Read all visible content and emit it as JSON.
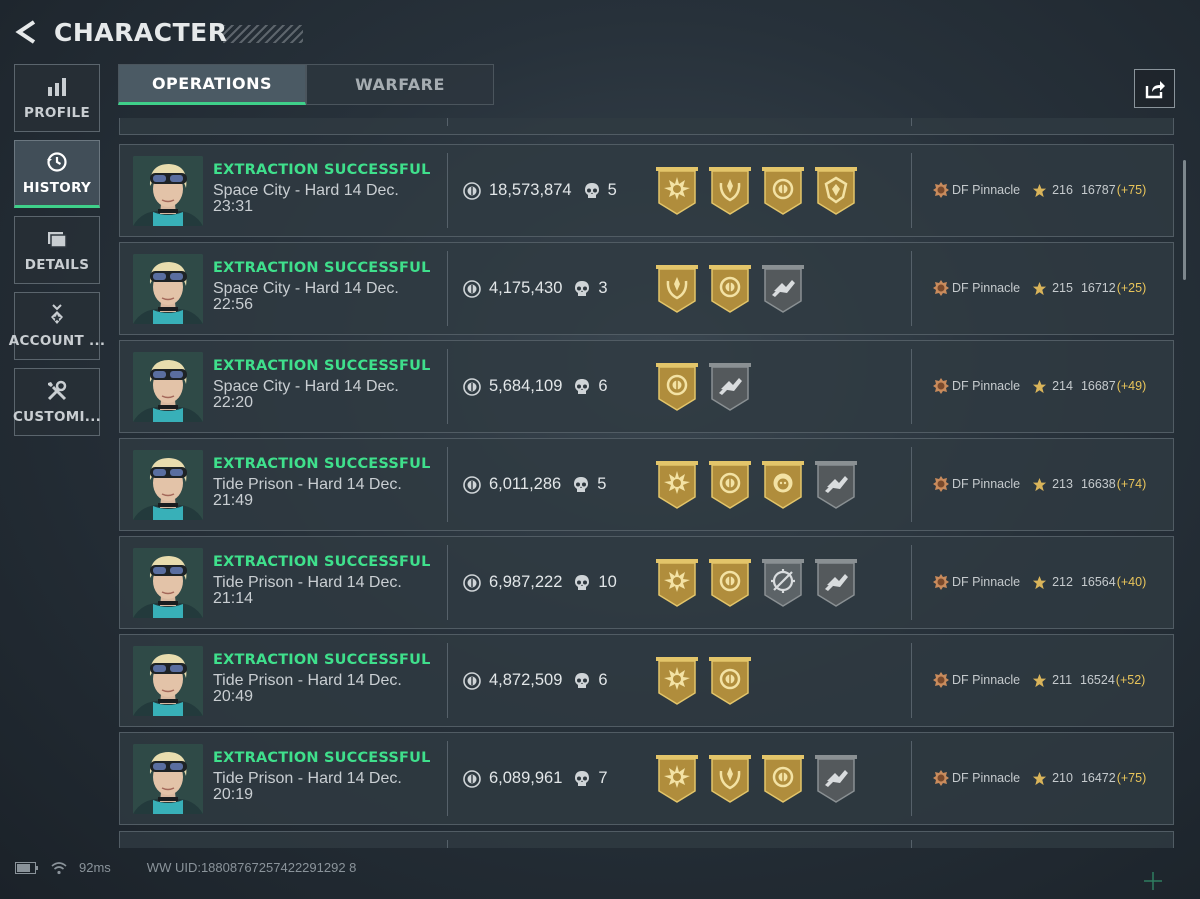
{
  "header": {
    "title": "CHARACTER"
  },
  "sidebar": {
    "items": [
      {
        "label": "PROFILE",
        "icon": "bar-chart-icon",
        "active": false
      },
      {
        "label": "HISTORY",
        "icon": "clock-history-icon",
        "active": true
      },
      {
        "label": "DETAILS",
        "icon": "folder-icon",
        "active": false
      },
      {
        "label": "ACCOUNT ...",
        "icon": "medal-icon",
        "active": false
      },
      {
        "label": "CUSTOMI...",
        "icon": "tools-icon",
        "active": false
      }
    ]
  },
  "tabs": [
    {
      "label": "OPERATIONS",
      "active": true
    },
    {
      "label": "WARFARE",
      "active": false
    }
  ],
  "colors": {
    "accent": "#3fd08a",
    "status": "#3fe08c",
    "gain": "#e8c45a",
    "badge_gold": "#c9a548",
    "badge_gray": "#6a6f73"
  },
  "matches": [
    {
      "status": "EXTRACTION SUCCESSFUL",
      "location": "Space City - Hard 14 Dec. 23:31",
      "value": "18,573,874",
      "kills": "5",
      "badges": [
        "sun-badge",
        "wreath-badge",
        "coin-badge",
        "shield-badge"
      ],
      "rank": "DF Pinnacle",
      "level": "216",
      "points": "16787",
      "gain": "(+75)"
    },
    {
      "status": "EXTRACTION SUCCESSFUL",
      "location": "Space City - Hard 14 Dec. 22:56",
      "value": "4,175,430",
      "kills": "3",
      "badges": [
        "wreath-badge",
        "coin-badge",
        "gray-hand-badge"
      ],
      "rank": "DF Pinnacle",
      "level": "215",
      "points": "16712",
      "gain": "(+25)"
    },
    {
      "status": "EXTRACTION SUCCESSFUL",
      "location": "Space City - Hard 14 Dec. 22:20",
      "value": "5,684,109",
      "kills": "6",
      "badges": [
        "coin-badge",
        "gray-hand-badge"
      ],
      "rank": "DF Pinnacle",
      "level": "214",
      "points": "16687",
      "gain": "(+49)"
    },
    {
      "status": "EXTRACTION SUCCESSFUL",
      "location": "Tide Prison - Hard 14 Dec. 21:49",
      "value": "6,011,286",
      "kills": "5",
      "badges": [
        "sun-badge",
        "coin-badge",
        "lion-badge",
        "gray-hand-badge"
      ],
      "rank": "DF Pinnacle",
      "level": "213",
      "points": "16638",
      "gain": "(+74)"
    },
    {
      "status": "EXTRACTION SUCCESSFUL",
      "location": "Tide Prison - Hard 14 Dec. 21:14",
      "value": "6,987,222",
      "kills": "10",
      "badges": [
        "sun-badge",
        "coin-badge",
        "crosshair-badge",
        "gray-hand-badge"
      ],
      "rank": "DF Pinnacle",
      "level": "212",
      "points": "16564",
      "gain": "(+40)"
    },
    {
      "status": "EXTRACTION SUCCESSFUL",
      "location": "Tide Prison - Hard 14 Dec. 20:49",
      "value": "4,872,509",
      "kills": "6",
      "badges": [
        "sun-badge",
        "coin-badge"
      ],
      "rank": "DF Pinnacle",
      "level": "211",
      "points": "16524",
      "gain": "(+52)"
    },
    {
      "status": "EXTRACTION SUCCESSFUL",
      "location": "Tide Prison - Hard 14 Dec. 20:19",
      "value": "6,089,961",
      "kills": "7",
      "badges": [
        "sun-badge",
        "wreath-badge",
        "coin-badge",
        "gray-hand-badge"
      ],
      "rank": "DF Pinnacle",
      "level": "210",
      "points": "16472",
      "gain": "(+75)"
    }
  ],
  "footer": {
    "ping": "92ms",
    "uid": "WW UID:18808767257422291292 8"
  }
}
